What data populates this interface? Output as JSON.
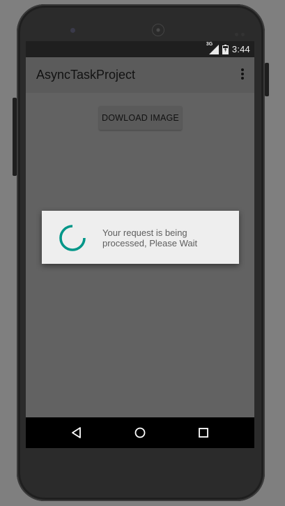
{
  "status_bar": {
    "network_label": "3G",
    "time": "3:44",
    "icons": [
      "signal-icon",
      "battery-icon"
    ]
  },
  "app_bar": {
    "title": "AsyncTaskProject",
    "overflow_icon": "more-vert-icon"
  },
  "main": {
    "download_button_label": "DOWLOAD IMAGE"
  },
  "dialog": {
    "message_line1": "Your request is being",
    "message_line2": "processed, Please Wait",
    "spinner_icon": "progress-spinner-icon"
  },
  "nav_bar": {
    "buttons": [
      "back-icon",
      "home-icon",
      "recents-icon"
    ]
  },
  "colors": {
    "accent": "#009688",
    "dialog_background": "#eeeeee",
    "scrim_app_bar": "#5b5b5b",
    "status_bar": "#1f1f1f"
  }
}
